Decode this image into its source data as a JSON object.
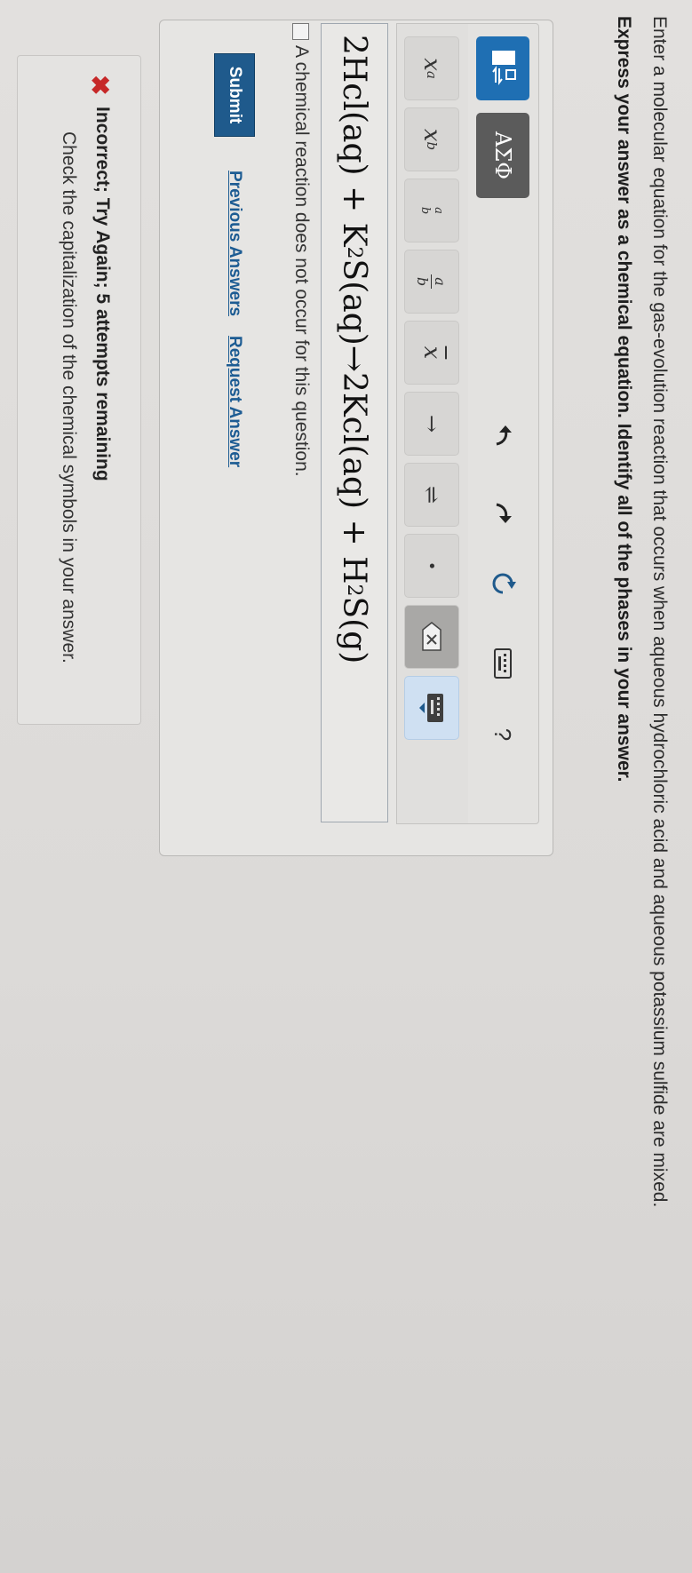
{
  "question": {
    "prompt": "Enter a molecular equation for the gas-evolution reaction that occurs when aqueous hydrochloric acid and aqueous potassium sulfide are mixed.",
    "instruction": "Express your answer as a chemical equation. Identify all of the phases in your answer."
  },
  "toolbar": {
    "row1": {
      "templates_icon": "templates-icon",
      "symbols_label": "ΑΣΦ",
      "undo_icon": "undo-icon",
      "redo_icon": "redo-icon",
      "reset_icon": "reset-icon",
      "keyboard_icon": "keyboard-icon",
      "help_label": "?"
    },
    "row2": {
      "superscript_label": "x",
      "superscript_sup": "a",
      "subscript_label": "x",
      "subscript_sub": "b",
      "fraction_small_num": "a",
      "fraction_small_den": "b",
      "fraction_num": "a",
      "fraction_den": "b",
      "overbar_label": "x",
      "arrow_label": "→",
      "equilibrium_label": "⇌",
      "dot_label": "•",
      "delete_icon": "delete-icon",
      "keyboard_toggle_icon": "keyboard-toggle-icon"
    }
  },
  "answer": {
    "parts": [
      "2Hcl(aq) + K",
      "2",
      "S(aq)→2Kcl(aq) + H",
      "2",
      "S(g)"
    ]
  },
  "no_reaction": {
    "label": "A chemical reaction does not occur for this question.",
    "checked": false
  },
  "actions": {
    "submit": "Submit",
    "previous_answers": "Previous Answers",
    "request_answer": "Request Answer"
  },
  "feedback": {
    "icon": "x-icon",
    "title": "Incorrect; Try Again; 5 attempts remaining",
    "message": "Check the capitalization of the chemical symbols in your answer."
  }
}
